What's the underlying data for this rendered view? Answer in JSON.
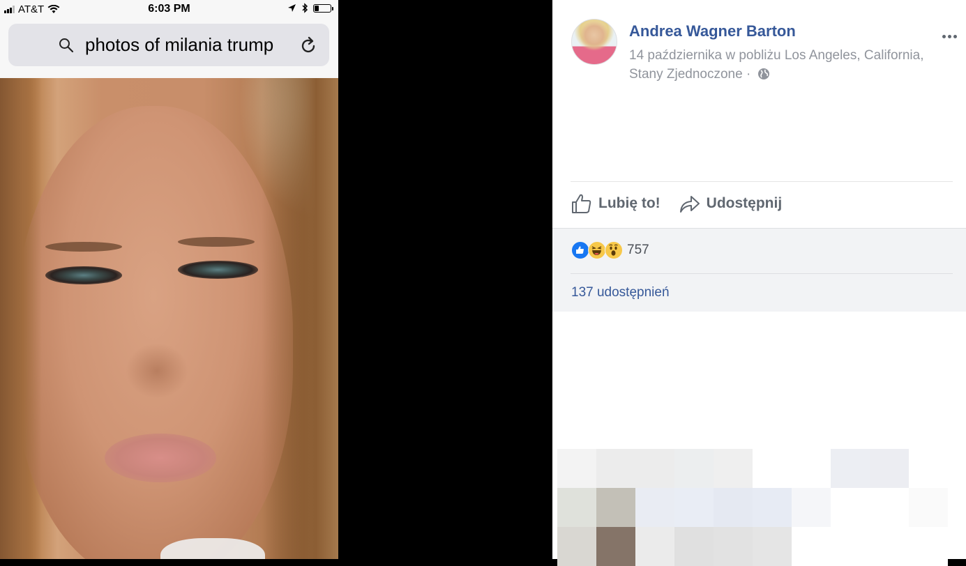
{
  "phone": {
    "status_bar": {
      "carrier": "AT&T",
      "time": "6:03 PM",
      "battery_level": 0.3
    },
    "url_bar": {
      "query": "photos of milania trump"
    }
  },
  "post": {
    "author": "Andrea Wagner Barton",
    "meta_line1": "14 października w pobliżu Los Angeles, California,",
    "meta_line2": "Stany Zjednoczone ·",
    "actions": {
      "like_label": "Lubię to!",
      "share_label": "Udostępnij"
    },
    "reactions": {
      "types": [
        "like",
        "haha",
        "wow"
      ],
      "count": "757"
    },
    "shares": "137 udostępnień",
    "colors": {
      "link_blue": "#365899",
      "meta_gray": "#90949c",
      "action_gray": "#606770",
      "panel_bg": "#f2f3f5"
    }
  },
  "pixelated_block_colors": [
    [
      "#f3f3f3",
      "#ececec",
      "#ececec",
      "#eceeef",
      "#efefef",
      "#ffffff",
      "#ffffff",
      "#eceef3",
      "#ecedf2",
      "#ffffff"
    ],
    [
      "#dfe1db",
      "#c3c0b7",
      "#e9ecf3",
      "#e9edf5",
      "#e5e9f2",
      "#e7ebf4",
      "#f5f6f9",
      "#ffffff",
      "#ffffff",
      "#fafafa"
    ],
    [
      "#d9d7d2",
      "#857468",
      "#ebebeb",
      "#e0e0e0",
      "#e2e2e2",
      "#e5e5e5",
      "#ffffff",
      "#ffffff",
      "#ffffff",
      "#ffffff"
    ]
  ]
}
